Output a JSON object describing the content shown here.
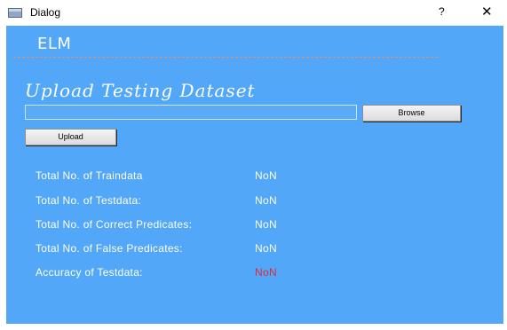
{
  "window": {
    "title": "Dialog",
    "help_glyph": "?",
    "close_glyph": "✕",
    "icon": "window-app-icon"
  },
  "app": {
    "title": "ELM",
    "section_title": "Upload Testing Dataset",
    "file_input_value": "",
    "browse_label": "Browse",
    "upload_label": "Upload"
  },
  "stats": [
    {
      "label": "Total No. of Traindata",
      "value": "NoN"
    },
    {
      "label": "Total No. of Testdata:",
      "value": "NoN"
    },
    {
      "label": "Total No. of Correct Predicates:",
      "value": "NoN"
    },
    {
      "label": "Total No. of False Predicates:",
      "value": "NoN"
    },
    {
      "label": "Accuracy of Testdata:",
      "value": "NoN"
    }
  ],
  "colors": {
    "background": "#52a7f8",
    "text": "#ffffff",
    "accuracy_value": "#e02b2b",
    "divider": "#e8915a"
  }
}
